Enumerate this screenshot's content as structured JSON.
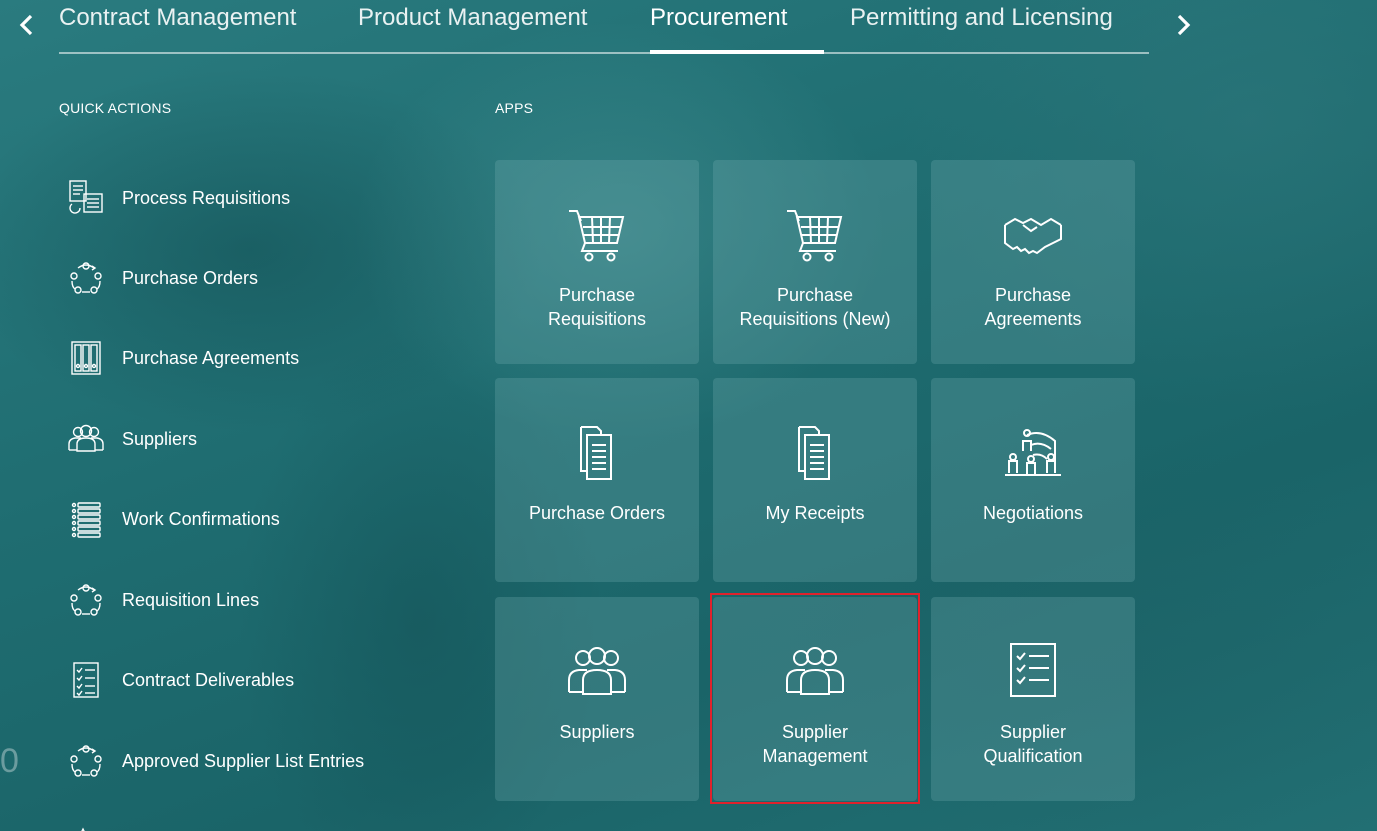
{
  "nav": {
    "tabs": [
      {
        "label": "Contract Management",
        "active": false
      },
      {
        "label": "Product Management",
        "active": false
      },
      {
        "label": "Procurement",
        "active": true
      },
      {
        "label": "Permitting and Licensing",
        "active": false
      }
    ],
    "prev_icon": "chevron-left-icon",
    "next_icon": "chevron-right-icon"
  },
  "quick_actions": {
    "title": "QUICK ACTIONS",
    "items": [
      {
        "label": "Process Requisitions",
        "icon": "process-requisitions-icon"
      },
      {
        "label": "Purchase Orders",
        "icon": "cycle-people-icon"
      },
      {
        "label": "Purchase Agreements",
        "icon": "binders-icon"
      },
      {
        "label": "Suppliers",
        "icon": "people-group-icon"
      },
      {
        "label": "Work Confirmations",
        "icon": "list-icon"
      },
      {
        "label": "Requisition Lines",
        "icon": "cycle-people-icon"
      },
      {
        "label": "Contract Deliverables",
        "icon": "checklist-icon"
      },
      {
        "label": "Approved Supplier List Entries",
        "icon": "cycle-people-icon"
      }
    ]
  },
  "apps": {
    "title": "APPS",
    "tiles": [
      {
        "label": "Purchase Requisitions",
        "icon": "shopping-cart-icon"
      },
      {
        "label": "Purchase Requisitions (New)",
        "icon": "shopping-cart-icon"
      },
      {
        "label": "Purchase Agreements",
        "icon": "handshake-icon"
      },
      {
        "label": "Purchase Orders",
        "icon": "documents-icon"
      },
      {
        "label": "My Receipts",
        "icon": "documents-icon"
      },
      {
        "label": "Negotiations",
        "icon": "negotiations-icon"
      },
      {
        "label": "Suppliers",
        "icon": "people-group-icon"
      },
      {
        "label": "Supplier Management",
        "icon": "people-group-icon"
      },
      {
        "label": "Supplier Qualification",
        "icon": "checklist-icon"
      }
    ]
  },
  "colors": {
    "background": "#1f6a6e",
    "highlight": "#e0222c"
  }
}
